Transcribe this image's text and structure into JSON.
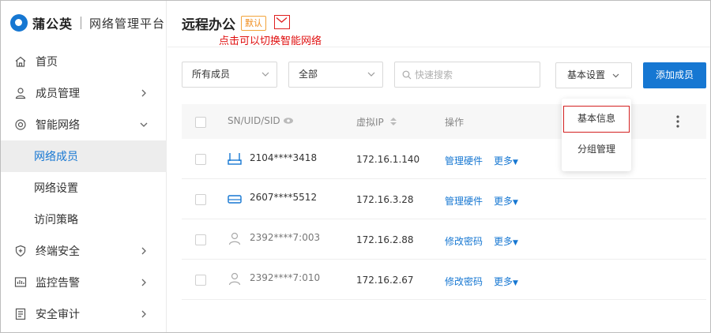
{
  "brand": {
    "name": "蒲公英",
    "subtitle": "网络管理平台"
  },
  "sidebar": {
    "items": [
      {
        "label": "首页",
        "icon": "home-icon"
      },
      {
        "label": "成员管理",
        "icon": "user-icon"
      },
      {
        "label": "智能网络",
        "icon": "network-icon"
      },
      {
        "label": "网络成员"
      },
      {
        "label": "网络设置"
      },
      {
        "label": "访问策略"
      },
      {
        "label": "终端安全",
        "icon": "shield-icon"
      },
      {
        "label": "监控告警",
        "icon": "chart-icon"
      },
      {
        "label": "安全审计",
        "icon": "document-icon"
      }
    ]
  },
  "header": {
    "title": "远程办公",
    "badge": "默认",
    "hint": "点击可以切换智能网络"
  },
  "filters": {
    "member_select": "所有成员",
    "status_select": "全部",
    "search_placeholder": "快速搜索",
    "settings_button": "基本设置",
    "add_button": "添加成员"
  },
  "settings_menu": [
    "基本信息",
    "分组管理"
  ],
  "table": {
    "columns": [
      "SN/UID/SID",
      "虚拟IP",
      "操作"
    ],
    "rows": [
      {
        "id": "2104****3418",
        "ip": "172.16.1.140",
        "action": "管理硬件",
        "more": "更多",
        "device": "router-icon"
      },
      {
        "id": "2607****5512",
        "ip": "172.16.3.28",
        "action": "管理硬件",
        "more": "更多",
        "device": "box-device-icon"
      },
      {
        "id": "2392****7:003",
        "ip": "172.16.2.88",
        "action": "修改密码",
        "more": "更多",
        "device": "user-icon"
      },
      {
        "id": "2392****7:010",
        "ip": "172.16.2.67",
        "action": "修改密码",
        "more": "更多",
        "device": "user-icon"
      }
    ]
  },
  "colors": {
    "accent": "#1677d2",
    "badge": "#f08c1a",
    "hint": "#e01010"
  }
}
